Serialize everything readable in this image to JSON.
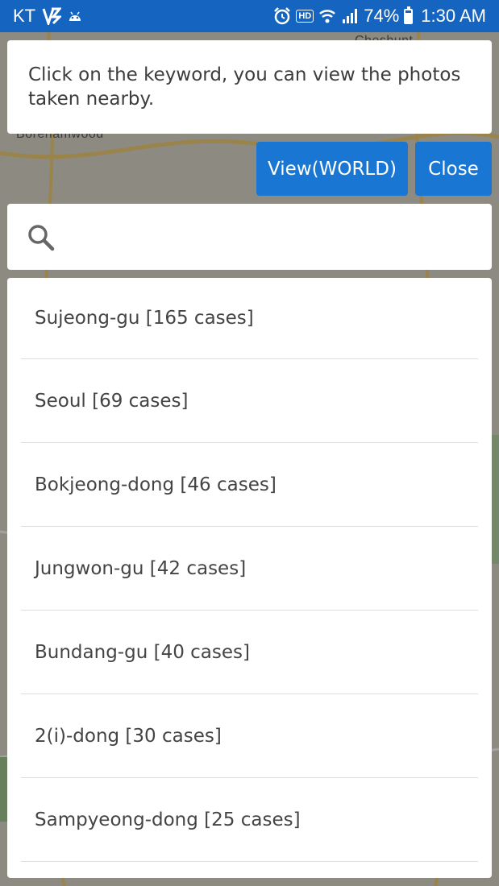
{
  "status_bar": {
    "carrier": "KT",
    "battery_percent": "74%",
    "battery_level": 0.74,
    "time": "1:30 AM",
    "icons": [
      "v-icon",
      "android-icon",
      "alarm-icon",
      "hd-icon",
      "wifi-icon",
      "signal-icon",
      "battery-icon"
    ],
    "hd_label": "HD"
  },
  "map": {
    "labels": [
      "Borehamwood",
      "Cheshunt"
    ]
  },
  "info": {
    "text": "Click on the keyword, you can view the photos taken nearby."
  },
  "buttons": {
    "view_world": "View(WORLD)",
    "close": "Close"
  },
  "search": {
    "value": "",
    "placeholder": ""
  },
  "keywords": [
    {
      "label": "Sujeong-gu [165 cases]"
    },
    {
      "label": "Seoul [69 cases]"
    },
    {
      "label": "Bokjeong-dong [46 cases]"
    },
    {
      "label": "Jungwon-gu [42 cases]"
    },
    {
      "label": "Bundang-gu [40 cases]"
    },
    {
      "label": "2(i)-dong [30 cases]"
    },
    {
      "label": "Sampyeong-dong [25 cases]"
    }
  ],
  "colors": {
    "status_bar": "#1565c0",
    "button": "#1976d2"
  }
}
